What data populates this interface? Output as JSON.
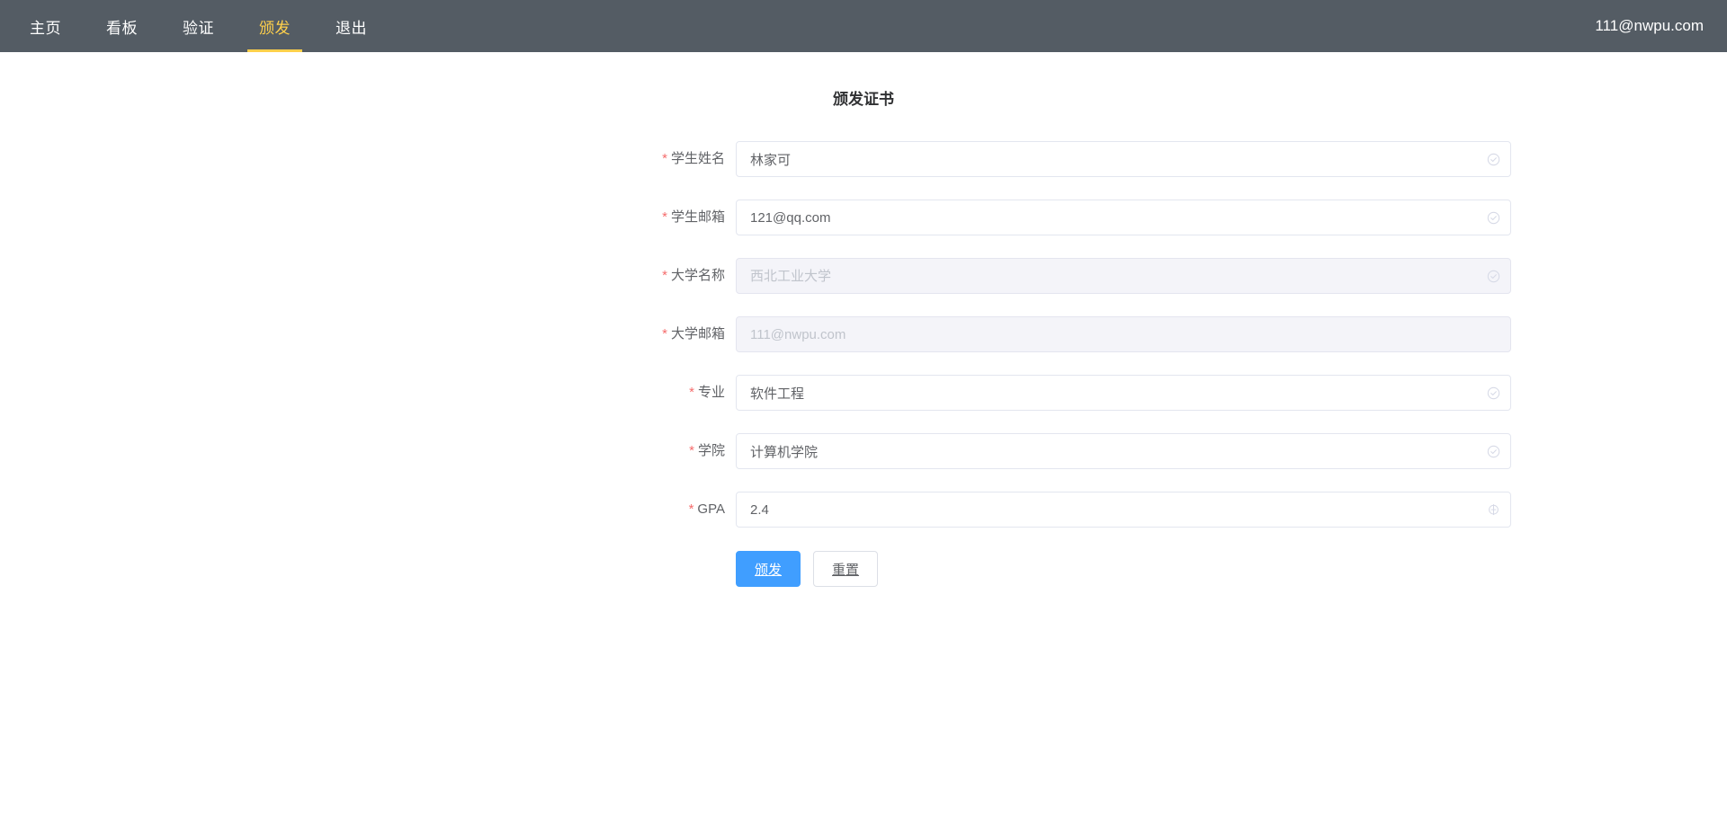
{
  "navbar": {
    "background_color": "#545c64",
    "active_color": "#ffd04b",
    "items": [
      {
        "label": "主页",
        "active": false
      },
      {
        "label": "看板",
        "active": false
      },
      {
        "label": "验证",
        "active": false
      },
      {
        "label": "颁发",
        "active": true
      },
      {
        "label": "退出",
        "active": false
      }
    ],
    "user_email": "111@nwpu.com"
  },
  "form": {
    "title": "颁发证书",
    "fields": [
      {
        "label": "学生姓名",
        "required": true,
        "value": "林家可",
        "placeholder": "",
        "disabled": false,
        "suffix_icon": "circle-check-icon"
      },
      {
        "label": "学生邮箱",
        "required": true,
        "value": "121@qq.com",
        "placeholder": "",
        "disabled": false,
        "suffix_icon": "circle-check-icon"
      },
      {
        "label": "大学名称",
        "required": true,
        "value": "",
        "placeholder": "西北工业大学",
        "disabled": true,
        "suffix_icon": "circle-check-icon"
      },
      {
        "label": "大学邮箱",
        "required": true,
        "value": "",
        "placeholder": "111@nwpu.com",
        "disabled": true,
        "suffix_icon": "none"
      },
      {
        "label": "专业",
        "required": true,
        "value": "软件工程",
        "placeholder": "",
        "disabled": false,
        "suffix_icon": "circle-check-icon"
      },
      {
        "label": "学院",
        "required": true,
        "value": "计算机学院",
        "placeholder": "",
        "disabled": false,
        "suffix_icon": "circle-check-icon"
      },
      {
        "label": "GPA",
        "required": true,
        "value": "2.4",
        "placeholder": "",
        "disabled": false,
        "suffix_icon": "circle-plus-icon"
      }
    ],
    "submit_label": "颁发",
    "reset_label": "重置",
    "primary_color": "#409eff",
    "required_marker": "*"
  }
}
